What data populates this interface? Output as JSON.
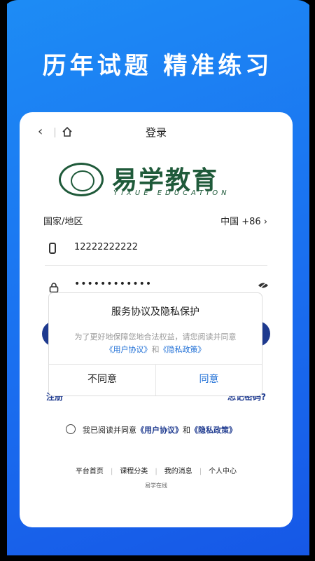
{
  "banner": {
    "headline": "历年试题 精准练习"
  },
  "topbar": {
    "title": "登录"
  },
  "logo": {
    "name_cn": "易学教育",
    "name_en": "YIXUE EDUCATION"
  },
  "form": {
    "country_label": "国家/地区",
    "country_value": "中国 +86 ›",
    "phone_value": "12222222222",
    "password_value": "••••••••••••"
  },
  "links": {
    "register": "注册",
    "forgot": "忘记密码?"
  },
  "agreement": {
    "prefix": "我已阅读并同意",
    "user_agreement": "《用户协议》",
    "and": "和",
    "privacy_policy": "《隐私政策》"
  },
  "footer": {
    "items": [
      "平台首页",
      "课程分类",
      "我的消息",
      "个人中心"
    ],
    "brand": "易学在线"
  },
  "modal": {
    "title": "服务协议及隐私保护",
    "body_prefix": "为了更好地保障您地合法权益，请您阅读并同意",
    "user_agreement": "《用户协议》",
    "and": "和",
    "privacy_policy": "《隐私政策》",
    "disagree": "不同意",
    "agree": "同意"
  },
  "colors": {
    "primary": "#1e3a8f",
    "accent": "#1f6fd6",
    "background": "#1a6ff0",
    "brand_green": "#1f5a3a"
  }
}
